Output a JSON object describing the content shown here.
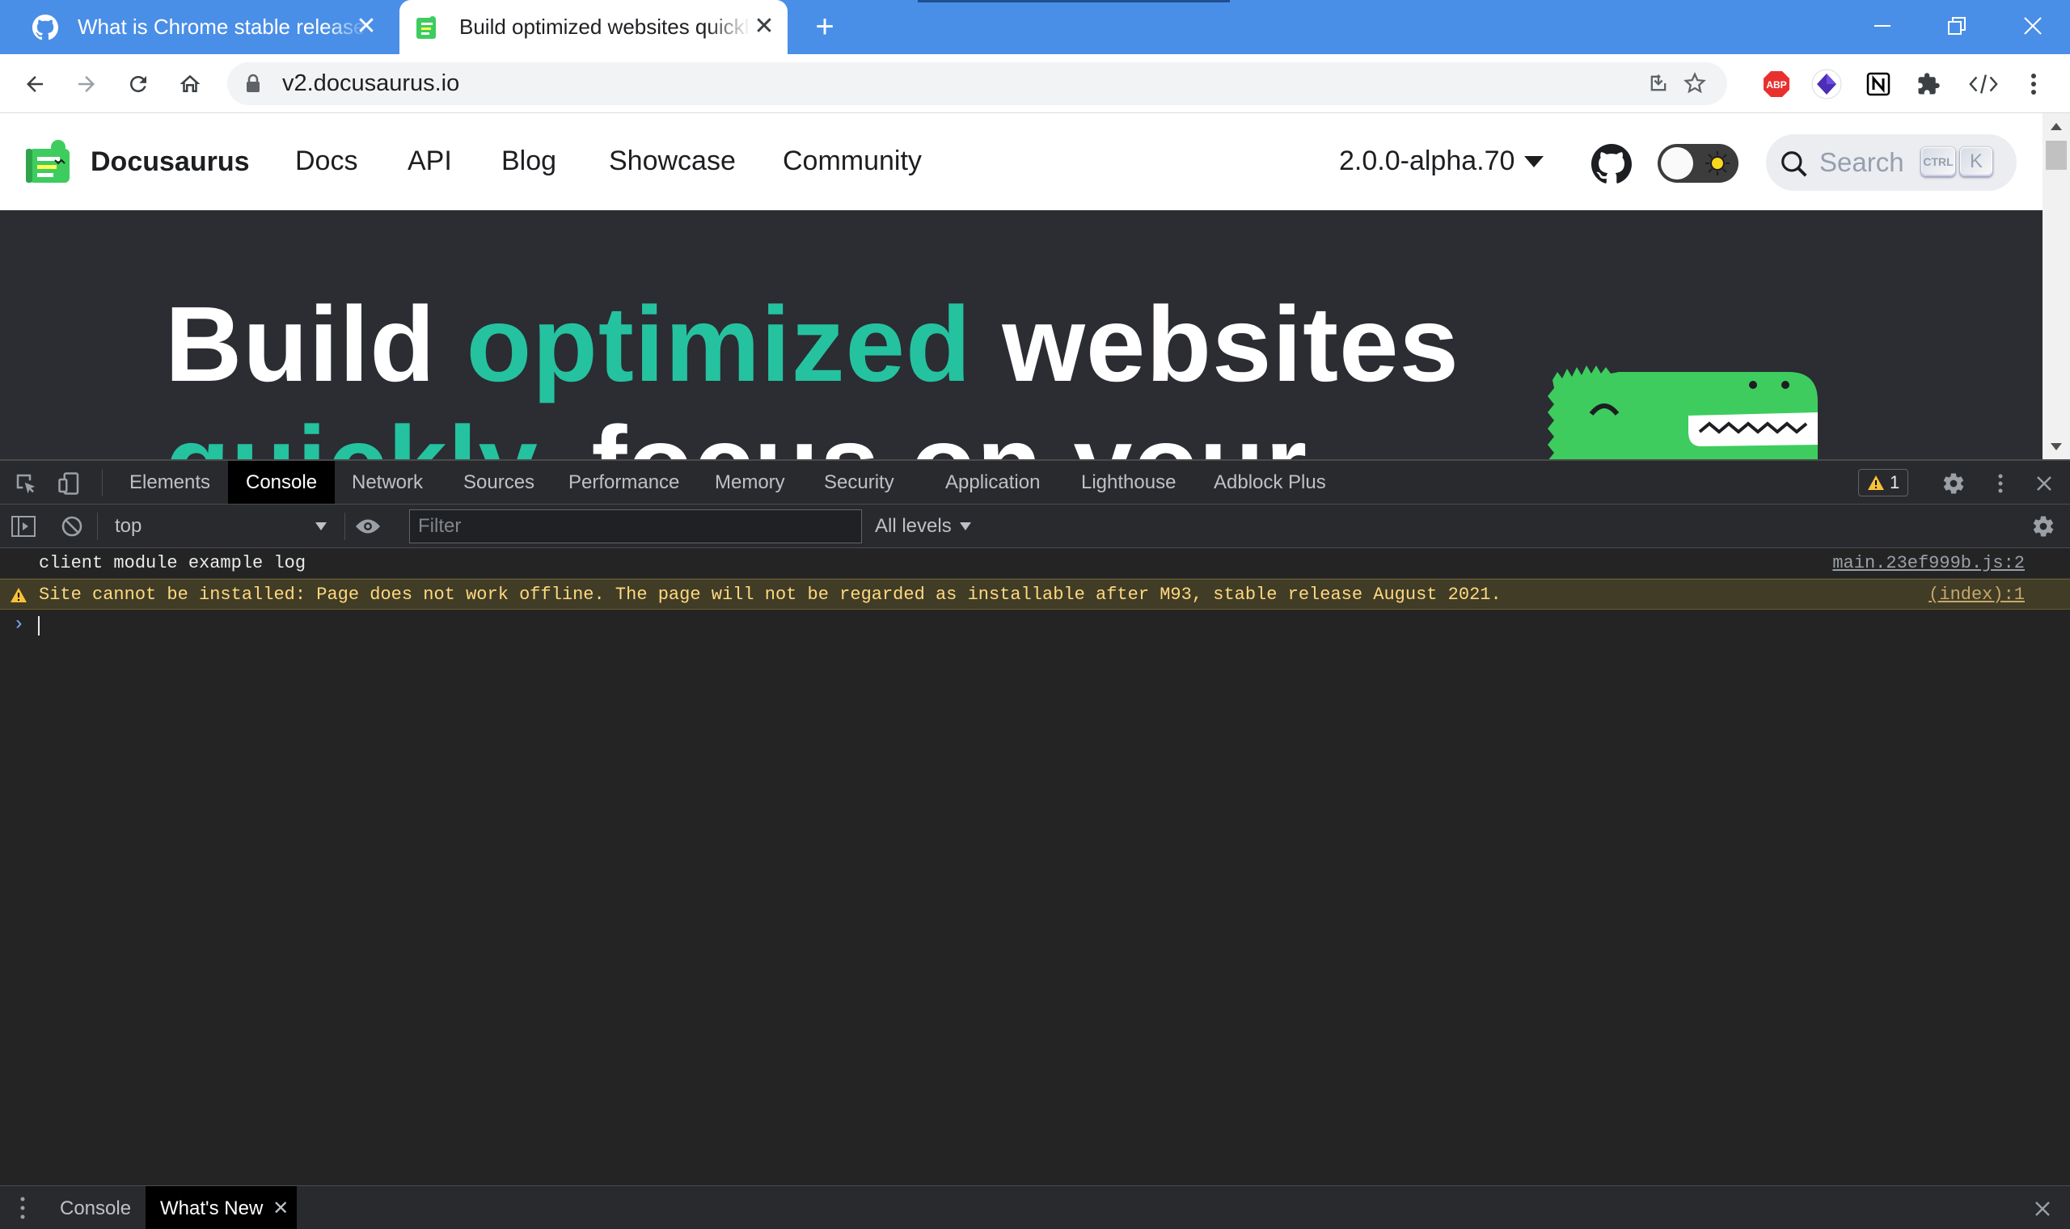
{
  "browser": {
    "tabs": [
      {
        "title": "What is Chrome stable release",
        "close": "✕"
      },
      {
        "title": "Build optimized websites quickly",
        "close": "✕"
      }
    ],
    "new_tab": "+",
    "url": "v2.docusaurus.io",
    "accent_color": "#4a8fe7"
  },
  "site": {
    "brand": "Docusaurus",
    "nav": [
      "Docs",
      "API",
      "Blog",
      "Showcase",
      "Community"
    ],
    "version": "2.0.0-alpha.70",
    "search_label": "Search",
    "kbd_ctrl": "CTRL",
    "kbd_k": "K",
    "hero": {
      "line1_a": "Build",
      "line1_b": "optimized",
      "line1_c": "websites",
      "line2_a": "quickly,",
      "line2_b": "focus on your"
    },
    "accent_color": "#25c2a0"
  },
  "devtools": {
    "tabs": [
      "Elements",
      "Console",
      "Network",
      "Sources",
      "Performance",
      "Memory",
      "Security",
      "Application",
      "Lighthouse",
      "Adblock Plus"
    ],
    "active_tab": "Console",
    "warning_count": "1",
    "context": "top",
    "filter_placeholder": "Filter",
    "levels": "All levels",
    "messages": [
      {
        "type": "log",
        "text": "client module example log",
        "source": "main.23ef999b.js:2"
      },
      {
        "type": "warning",
        "text": "Site cannot be installed: Page does not work offline. The page will not be regarded as installable after M93, stable release August 2021.",
        "source": "(index):1"
      }
    ],
    "prompt": "›",
    "drawer_tabs": [
      {
        "label": "Console"
      },
      {
        "label": "What's New",
        "close": "✕"
      }
    ]
  }
}
